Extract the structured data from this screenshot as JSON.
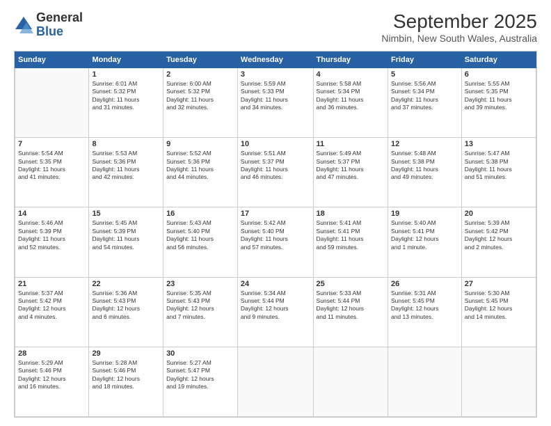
{
  "header": {
    "logo_general": "General",
    "logo_blue": "Blue",
    "title": "September 2025",
    "subtitle": "Nimbin, New South Wales, Australia"
  },
  "weekdays": [
    "Sunday",
    "Monday",
    "Tuesday",
    "Wednesday",
    "Thursday",
    "Friday",
    "Saturday"
  ],
  "weeks": [
    [
      {
        "day": "",
        "detail": ""
      },
      {
        "day": "1",
        "detail": "Sunrise: 6:01 AM\nSunset: 5:32 PM\nDaylight: 11 hours\nand 31 minutes."
      },
      {
        "day": "2",
        "detail": "Sunrise: 6:00 AM\nSunset: 5:32 PM\nDaylight: 11 hours\nand 32 minutes."
      },
      {
        "day": "3",
        "detail": "Sunrise: 5:59 AM\nSunset: 5:33 PM\nDaylight: 11 hours\nand 34 minutes."
      },
      {
        "day": "4",
        "detail": "Sunrise: 5:58 AM\nSunset: 5:34 PM\nDaylight: 11 hours\nand 36 minutes."
      },
      {
        "day": "5",
        "detail": "Sunrise: 5:56 AM\nSunset: 5:34 PM\nDaylight: 11 hours\nand 37 minutes."
      },
      {
        "day": "6",
        "detail": "Sunrise: 5:55 AM\nSunset: 5:35 PM\nDaylight: 11 hours\nand 39 minutes."
      }
    ],
    [
      {
        "day": "7",
        "detail": "Sunrise: 5:54 AM\nSunset: 5:35 PM\nDaylight: 11 hours\nand 41 minutes."
      },
      {
        "day": "8",
        "detail": "Sunrise: 5:53 AM\nSunset: 5:36 PM\nDaylight: 11 hours\nand 42 minutes."
      },
      {
        "day": "9",
        "detail": "Sunrise: 5:52 AM\nSunset: 5:36 PM\nDaylight: 11 hours\nand 44 minutes."
      },
      {
        "day": "10",
        "detail": "Sunrise: 5:51 AM\nSunset: 5:37 PM\nDaylight: 11 hours\nand 46 minutes."
      },
      {
        "day": "11",
        "detail": "Sunrise: 5:49 AM\nSunset: 5:37 PM\nDaylight: 11 hours\nand 47 minutes."
      },
      {
        "day": "12",
        "detail": "Sunrise: 5:48 AM\nSunset: 5:38 PM\nDaylight: 11 hours\nand 49 minutes."
      },
      {
        "day": "13",
        "detail": "Sunrise: 5:47 AM\nSunset: 5:38 PM\nDaylight: 11 hours\nand 51 minutes."
      }
    ],
    [
      {
        "day": "14",
        "detail": "Sunrise: 5:46 AM\nSunset: 5:39 PM\nDaylight: 11 hours\nand 52 minutes."
      },
      {
        "day": "15",
        "detail": "Sunrise: 5:45 AM\nSunset: 5:39 PM\nDaylight: 11 hours\nand 54 minutes."
      },
      {
        "day": "16",
        "detail": "Sunrise: 5:43 AM\nSunset: 5:40 PM\nDaylight: 11 hours\nand 56 minutes."
      },
      {
        "day": "17",
        "detail": "Sunrise: 5:42 AM\nSunset: 5:40 PM\nDaylight: 11 hours\nand 57 minutes."
      },
      {
        "day": "18",
        "detail": "Sunrise: 5:41 AM\nSunset: 5:41 PM\nDaylight: 11 hours\nand 59 minutes."
      },
      {
        "day": "19",
        "detail": "Sunrise: 5:40 AM\nSunset: 5:41 PM\nDaylight: 12 hours\nand 1 minute."
      },
      {
        "day": "20",
        "detail": "Sunrise: 5:39 AM\nSunset: 5:42 PM\nDaylight: 12 hours\nand 2 minutes."
      }
    ],
    [
      {
        "day": "21",
        "detail": "Sunrise: 5:37 AM\nSunset: 5:42 PM\nDaylight: 12 hours\nand 4 minutes."
      },
      {
        "day": "22",
        "detail": "Sunrise: 5:36 AM\nSunset: 5:43 PM\nDaylight: 12 hours\nand 6 minutes."
      },
      {
        "day": "23",
        "detail": "Sunrise: 5:35 AM\nSunset: 5:43 PM\nDaylight: 12 hours\nand 7 minutes."
      },
      {
        "day": "24",
        "detail": "Sunrise: 5:34 AM\nSunset: 5:44 PM\nDaylight: 12 hours\nand 9 minutes."
      },
      {
        "day": "25",
        "detail": "Sunrise: 5:33 AM\nSunset: 5:44 PM\nDaylight: 12 hours\nand 11 minutes."
      },
      {
        "day": "26",
        "detail": "Sunrise: 5:31 AM\nSunset: 5:45 PM\nDaylight: 12 hours\nand 13 minutes."
      },
      {
        "day": "27",
        "detail": "Sunrise: 5:30 AM\nSunset: 5:45 PM\nDaylight: 12 hours\nand 14 minutes."
      }
    ],
    [
      {
        "day": "28",
        "detail": "Sunrise: 5:29 AM\nSunset: 5:46 PM\nDaylight: 12 hours\nand 16 minutes."
      },
      {
        "day": "29",
        "detail": "Sunrise: 5:28 AM\nSunset: 5:46 PM\nDaylight: 12 hours\nand 18 minutes."
      },
      {
        "day": "30",
        "detail": "Sunrise: 5:27 AM\nSunset: 5:47 PM\nDaylight: 12 hours\nand 19 minutes."
      },
      {
        "day": "",
        "detail": ""
      },
      {
        "day": "",
        "detail": ""
      },
      {
        "day": "",
        "detail": ""
      },
      {
        "day": "",
        "detail": ""
      }
    ]
  ]
}
